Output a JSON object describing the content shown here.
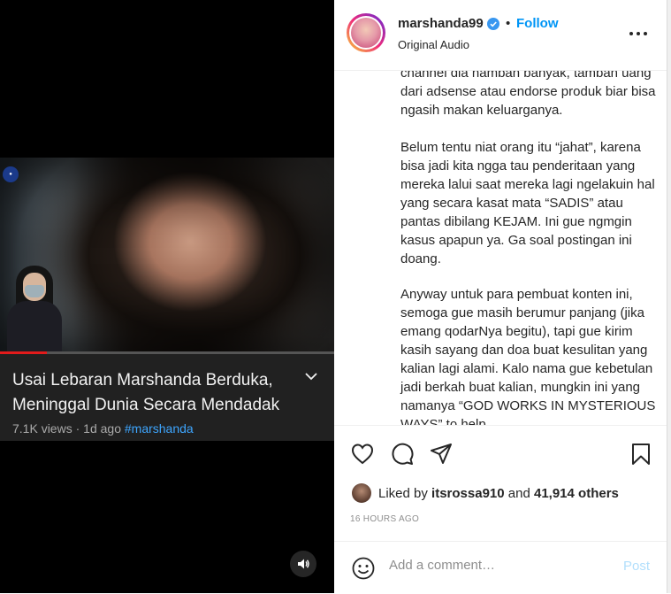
{
  "video": {
    "title": "Usai Lebaran Marshanda Berduka, Meninggal Dunia Secara Mendadak",
    "views": "7.1K views",
    "separator": "·",
    "age": "1d ago",
    "hashtag": "#marshanda",
    "progress_fraction": 0.14,
    "icons": {
      "expand": "chevron-down-icon",
      "volume": "speaker-icon"
    }
  },
  "post": {
    "username": "marshanda99",
    "dot": "•",
    "follow_label": "Follow",
    "audio": "Original Audio",
    "caption_paragraphs": [
      "channel dia nambah banyak, tambah uang dari adsense atau endorse produk biar bisa ngasih makan keluarganya.",
      "Belum tentu niat orang itu “jahat”, karena bisa jadi kita ngga tau penderitaan yang mereka lalui saat mereka lagi ngelakuin hal yang secara kasat mata “SADIS” atau pantas dibilang KEJAM. Ini gue ngmgin kasus apapun ya. Ga soal postingan ini doang.",
      "Anyway untuk para pembuat konten ini, semoga gue masih berumur panjang (jika emang qodarNya begitu), tapi gue kirim kasih sayang dan doa buat kesulitan yang kalian lagi alami. Kalo nama gue kebetulan jadi berkah buat kalian, mungkin ini yang namanya “GOD WORKS IN MYSTERIOUS WAYS” to help"
    ],
    "likes": {
      "prefix": "Liked by",
      "user": "itsrossa910",
      "and": "and",
      "count": "41,914 others"
    },
    "timestamp": "16 HOURS AGO",
    "comment_placeholder": "Add a comment…",
    "post_label": "Post",
    "icons": {
      "like": "heart-icon",
      "comment": "comment-icon",
      "share": "send-icon",
      "save": "bookmark-icon",
      "more": "more-icon",
      "emoji": "emoji-icon",
      "verified": "verified-badge-icon"
    },
    "colors": {
      "accent": "#0095f6",
      "verified": "#3897f0",
      "post_disabled": "#b2dffc"
    }
  }
}
